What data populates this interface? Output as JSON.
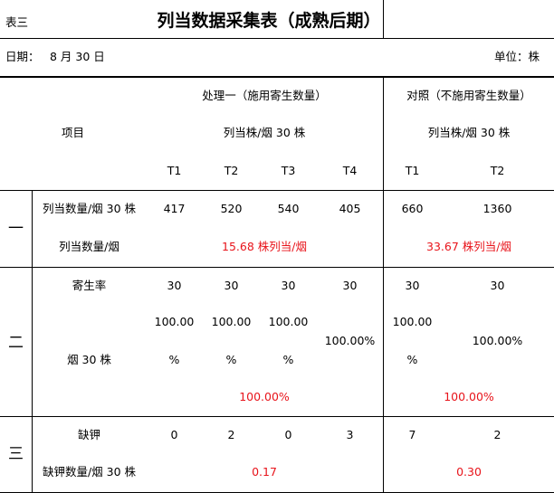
{
  "table_no": "表三",
  "title": "列当数据采集表（成熟后期）",
  "date_label": "日期：",
  "date_value": "8 月 30 日",
  "unit_label": "单位：株",
  "header": {
    "item": "项目",
    "treatment_title": "处理一（施用寄生数量）",
    "treatment_sub": "列当株/烟 30 株",
    "control_title": "对照（不施用寄生数量）",
    "control_sub": "列当株/烟 30 株",
    "cols": [
      "T1",
      "T2",
      "T3",
      "T4",
      "T1",
      "T2"
    ]
  },
  "section1": {
    "num": "一",
    "row1_label": "列当数量/烟 30 株",
    "row1_values": [
      "417",
      "520",
      "540",
      "405",
      "660",
      "1360"
    ],
    "row2_label": "列当数量/烟",
    "row2_treatment": "15.68 株列当/烟",
    "row2_control": "33.67 株列当/烟"
  },
  "section2": {
    "num": "二",
    "row1_label": "寄生率",
    "row1_values": [
      "30",
      "30",
      "30",
      "30",
      "30",
      "30"
    ],
    "row2_label": "烟 30 株",
    "row2_v1_a": "100.00",
    "row2_v1_b": "%",
    "row2_v2_a": "100.00",
    "row2_v2_b": "%",
    "row2_v3_a": "100.00",
    "row2_v3_b": "%",
    "row2_v4": "100.00%",
    "row2_v5_a": "100.00",
    "row2_v5_b": "%",
    "row2_v6": "100.00%",
    "row3_treatment": "100.00%",
    "row3_control": "100.00%"
  },
  "section3": {
    "num": "三",
    "row1_label": "缺钾",
    "row1_values": [
      "0",
      "2",
      "0",
      "3",
      "7",
      "2"
    ],
    "row2_label": "缺钾数量/烟 30 株",
    "row2_treatment": "0.17",
    "row2_control": "0.30"
  }
}
